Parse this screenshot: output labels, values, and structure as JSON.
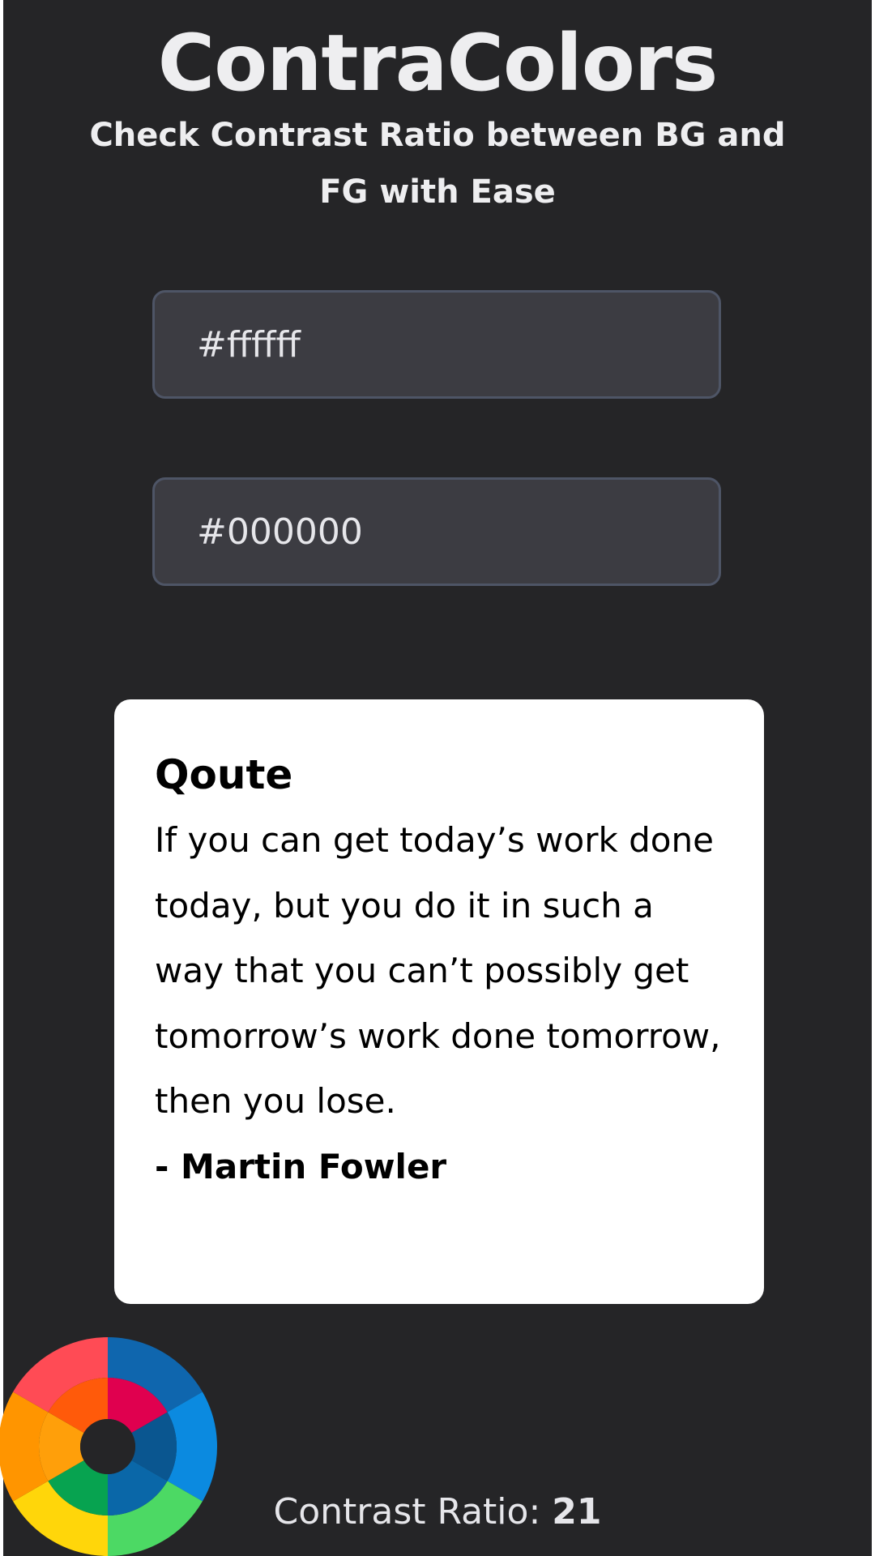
{
  "header": {
    "title": "ContraColors",
    "subtitle": "Check Contrast Ratio between BG and FG with Ease"
  },
  "inputs": {
    "background_color": "#ffffff",
    "foreground_color": "#000000"
  },
  "preview_card": {
    "heading": "Qoute",
    "quote": "If you can get today’s work done today, but you do it in such a way that you can’t possibly get tomorrow’s work done tomorrow, then you lose.",
    "author": "- Martin Fowler",
    "background_color": "#ffffff",
    "text_color": "#000000"
  },
  "result": {
    "label": "Contrast Ratio:",
    "value": "21"
  },
  "logo": {
    "icon": "color-wheel-icon",
    "colors": [
      "#0f66ae",
      "#0b8ae0",
      "#4cd964",
      "#ffd60a",
      "#ff9500",
      "#ff4b55",
      "#e0004f",
      "#0a5690",
      "#0a67a8",
      "#07a350",
      "#ff9f0a",
      "#ff5a0a"
    ]
  },
  "theme": {
    "app_background": "#252527",
    "input_background": "#3c3c42",
    "input_border": "#4e5566",
    "text_light": "#eeeef0"
  }
}
